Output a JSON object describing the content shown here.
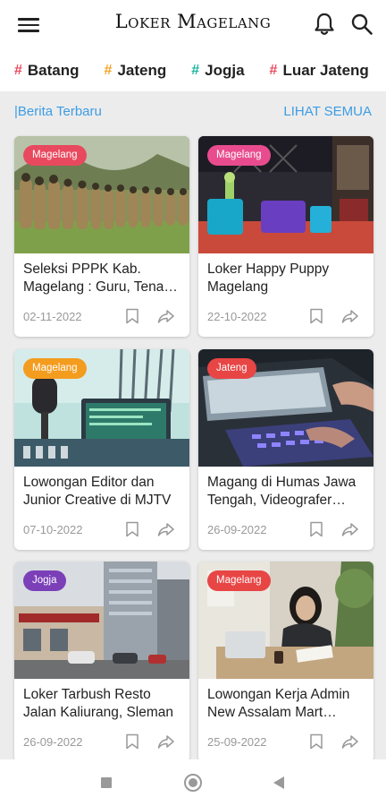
{
  "app": {
    "title": "Loker Magelang"
  },
  "tags": [
    {
      "label": "Batang",
      "color": "#e8495e"
    },
    {
      "label": "Jateng",
      "color": "#f2a527"
    },
    {
      "label": "Jogja",
      "color": "#1bb39c"
    },
    {
      "label": "Luar Jateng",
      "color": "#e8495e"
    }
  ],
  "section": {
    "label": "|Berita Terbaru",
    "more": "LIHAT SEMUA"
  },
  "cards": [
    {
      "badge": "Magelang",
      "badge_color": "#e8495e",
      "title": "Seleksi PPPK Kab. Magelang : Guru, Tenaga Kesehatan",
      "date": "02-11-2022",
      "image": "officials-ceremony"
    },
    {
      "badge": "Magelang",
      "badge_color": "#e84c8e",
      "title": "Loker Happy Puppy Magelang",
      "date": "22-10-2022",
      "image": "karaoke-room"
    },
    {
      "badge": "Magelang",
      "badge_color": "#f39c1e",
      "title": "Lowongan Editor dan Junior Creative di MJTV",
      "date": "07-10-2022",
      "image": "radio-studio"
    },
    {
      "badge": "Jateng",
      "badge_color": "#e84545",
      "title": "Magang di Humas Jawa Tengah, Videografer Hingga Fotografer",
      "date": "26-09-2022",
      "image": "laptop-typing"
    },
    {
      "badge": "Jogja",
      "badge_color": "#7b3fb8",
      "title": "Loker Tarbush Resto Jalan Kaliurang, Sleman",
      "date": "26-09-2022",
      "image": "city-street"
    },
    {
      "badge": "Magelang",
      "badge_color": "#e84545",
      "title": "Lowongan Kerja Admin New Assalam Mart Magelang",
      "date": "25-09-2022",
      "image": "woman-office"
    }
  ]
}
